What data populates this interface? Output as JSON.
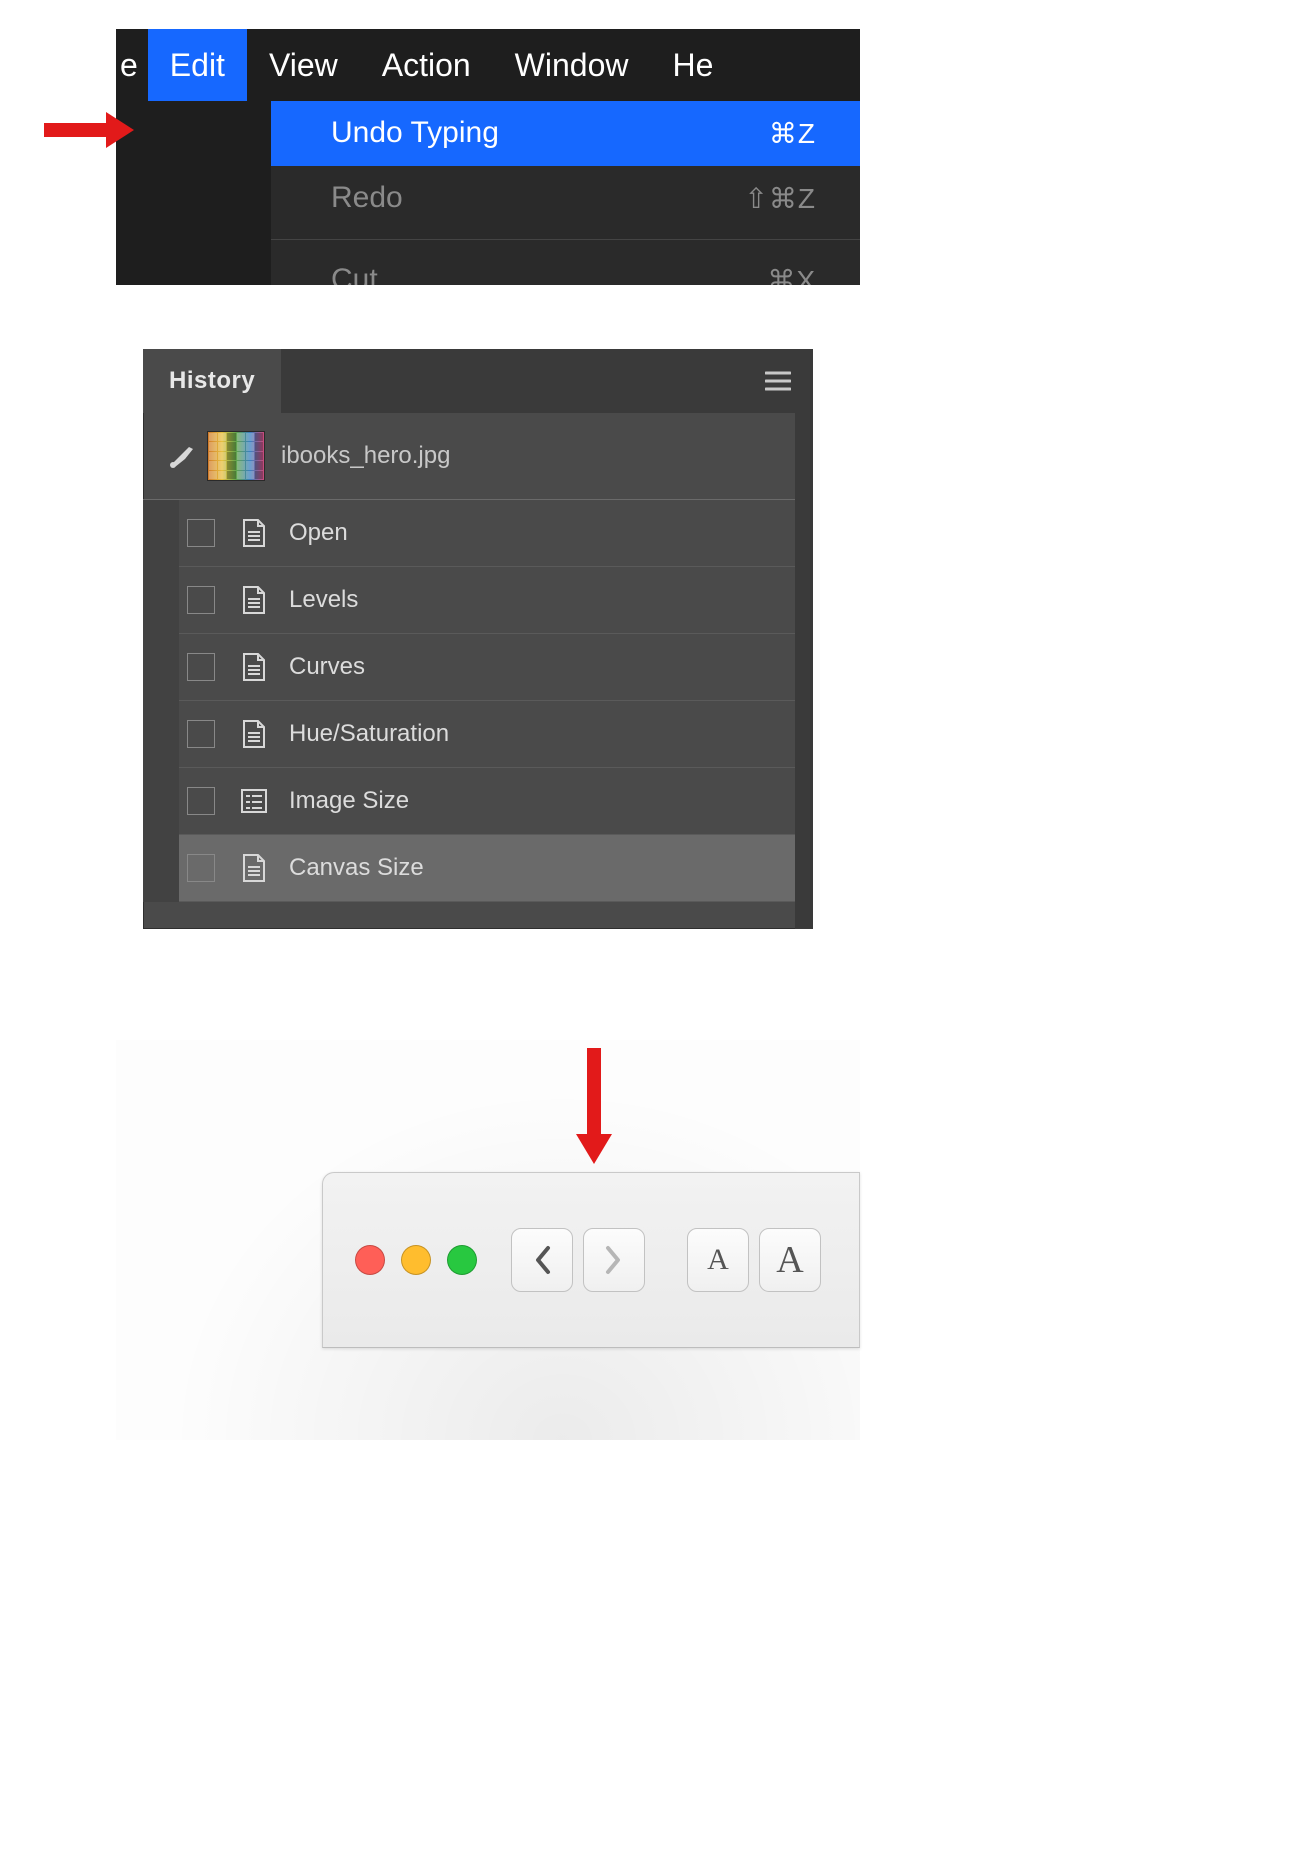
{
  "menu": {
    "frag_left": "e",
    "items": [
      "Edit",
      "View",
      "Action",
      "Window",
      "He"
    ],
    "active_index": 0,
    "dropdown": [
      {
        "label": "Undo Typing",
        "shortcut": "⌘Z",
        "selected": true
      },
      {
        "label": "Redo",
        "shortcut": "⇧⌘Z",
        "selected": false
      },
      {
        "label": "Cut",
        "shortcut": "⌘X",
        "selected": false
      }
    ]
  },
  "history": {
    "panel_title": "History",
    "file_name": "ibooks_hero.jpg",
    "icon_type": "brush-icon",
    "steps": [
      {
        "label": "Open",
        "icon": "document"
      },
      {
        "label": "Levels",
        "icon": "document"
      },
      {
        "label": "Curves",
        "icon": "document"
      },
      {
        "label": "Hue/Saturation",
        "icon": "document"
      },
      {
        "label": "Image Size",
        "icon": "list"
      },
      {
        "label": "Canvas Size",
        "icon": "document",
        "selected": true
      }
    ]
  },
  "toolbar": {
    "traffic": [
      "close",
      "minimize",
      "zoom"
    ],
    "nav_back": "‹",
    "nav_fwd": "›",
    "font_small": "A",
    "font_large": "A"
  }
}
